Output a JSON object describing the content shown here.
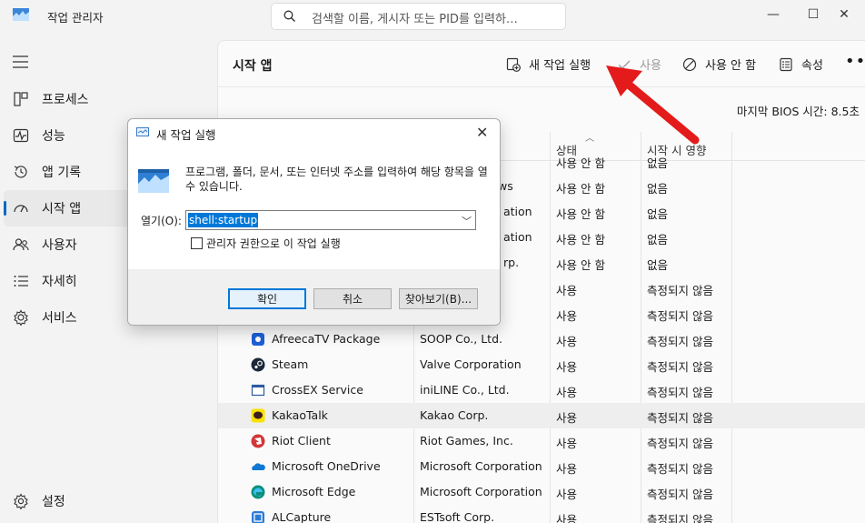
{
  "window": {
    "title": "작업 관리자",
    "search_placeholder": "검색할 이름, 게시자 또는 PID를 입력하…",
    "minimize": "—",
    "maximize": "☐",
    "close": "✕"
  },
  "sidebar": {
    "menu_icon": "hamburger-icon",
    "items": [
      {
        "label": "프로세스",
        "icon": "processes-icon"
      },
      {
        "label": "성능",
        "icon": "performance-icon"
      },
      {
        "label": "앱 기록",
        "icon": "history-icon"
      },
      {
        "label": "시작 앱",
        "icon": "startup-icon",
        "active": true
      },
      {
        "label": "사용자",
        "icon": "users-icon"
      },
      {
        "label": "자세히",
        "icon": "details-icon"
      },
      {
        "label": "서비스",
        "icon": "services-icon"
      }
    ],
    "settings_label": "설정"
  },
  "main": {
    "title": "시작 앱",
    "toolbar": {
      "run_new_task": "새 작업 실행",
      "enable": "사용",
      "disable": "사용 안 함",
      "properties": "속성",
      "more": "•••"
    },
    "bios_label": "마지막 BIOS 시간:",
    "bios_value": "8.5초",
    "columns": {
      "status": "상태",
      "startup_impact": "시작 시 영향"
    },
    "partial_rows": [
      {
        "publisher": "",
        "status": "사용 안 함",
        "impact": "없음"
      },
      {
        "publisher": "ws",
        "status": "사용 안 함",
        "impact": "없음"
      },
      {
        "publisher": "ation",
        "status": "사용 안 함",
        "impact": "없음"
      },
      {
        "publisher": "ation",
        "status": "사용 안 함",
        "impact": "없음"
      },
      {
        "publisher": "rp.",
        "status": "사용 안 함",
        "impact": "없음"
      },
      {
        "publisher": "",
        "status": "사용",
        "impact": "측정되지 않음"
      },
      {
        "publisher": "",
        "status": "사용",
        "impact": "측정되지 않음"
      }
    ],
    "rows": [
      {
        "name": "AfreecaTV Package",
        "publisher": "SOOP Co., Ltd.",
        "status": "사용",
        "impact": "측정되지 않음",
        "icon": "afreecatv-icon"
      },
      {
        "name": "Steam",
        "publisher": "Valve Corporation",
        "status": "사용",
        "impact": "측정되지 않음",
        "icon": "steam-icon"
      },
      {
        "name": "CrossEX Service",
        "publisher": "iniLINE Co., Ltd.",
        "status": "사용",
        "impact": "측정되지 않음",
        "icon": "crossex-icon"
      },
      {
        "name": "KakaoTalk",
        "publisher": "Kakao Corp.",
        "status": "사용",
        "impact": "측정되지 않음",
        "icon": "kakaotalk-icon",
        "highlight": true
      },
      {
        "name": "Riot Client",
        "publisher": "Riot Games, Inc.",
        "status": "사용",
        "impact": "측정되지 않음",
        "icon": "riot-icon"
      },
      {
        "name": "Microsoft OneDrive",
        "publisher": "Microsoft Corporation",
        "status": "사용",
        "impact": "측정되지 않음",
        "icon": "onedrive-icon"
      },
      {
        "name": "Microsoft Edge",
        "publisher": "Microsoft Corporation",
        "status": "사용",
        "impact": "측정되지 않음",
        "icon": "edge-icon"
      },
      {
        "name": "ALCapture",
        "publisher": "ESTsoft Corp.",
        "status": "사용",
        "impact": "측정되지 않음",
        "icon": "alcapture-icon"
      }
    ]
  },
  "dialog": {
    "title": "새 작업 실행",
    "close": "✕",
    "description": "프로그램, 폴더, 문서, 또는 인터넷 주소를 입력하여 해당 항목을 열 수 있습니다.",
    "open_label": "열기(O):",
    "open_value": "shell:startup",
    "admin_checkbox_label": "관리자 권한으로 이 작업 실행",
    "admin_checked": false,
    "ok": "확인",
    "cancel": "취소",
    "browse": "찾아보기(B)..."
  },
  "colors": {
    "accent": "#0067c0",
    "annotation_arrow": "#e31b1b"
  }
}
